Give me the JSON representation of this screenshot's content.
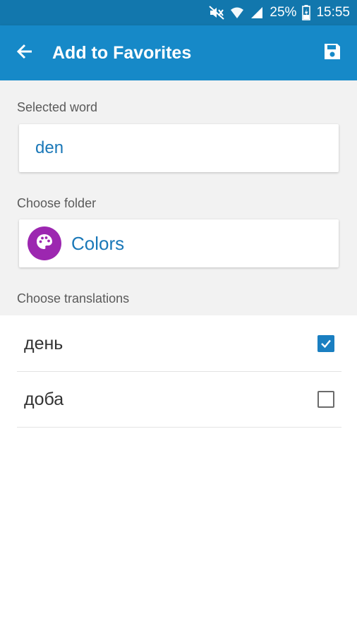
{
  "status_bar": {
    "battery": "25%",
    "time": "15:55",
    "icons": [
      "mute-icon",
      "wifi-icon",
      "signal-icon",
      "battery-charging-icon"
    ]
  },
  "app_bar": {
    "title": "Add to Favorites",
    "back_icon": "arrow-back-icon",
    "save_icon": "save-icon",
    "color": "#1689c8"
  },
  "selected_word": {
    "label": "Selected word",
    "value": "den"
  },
  "folder": {
    "label": "Choose folder",
    "name": "Colors",
    "icon": "palette-icon",
    "icon_color": "#9c27b0"
  },
  "translations": {
    "label": "Choose translations",
    "items": [
      {
        "text": "день",
        "checked": true
      },
      {
        "text": "доба",
        "checked": false
      }
    ]
  }
}
